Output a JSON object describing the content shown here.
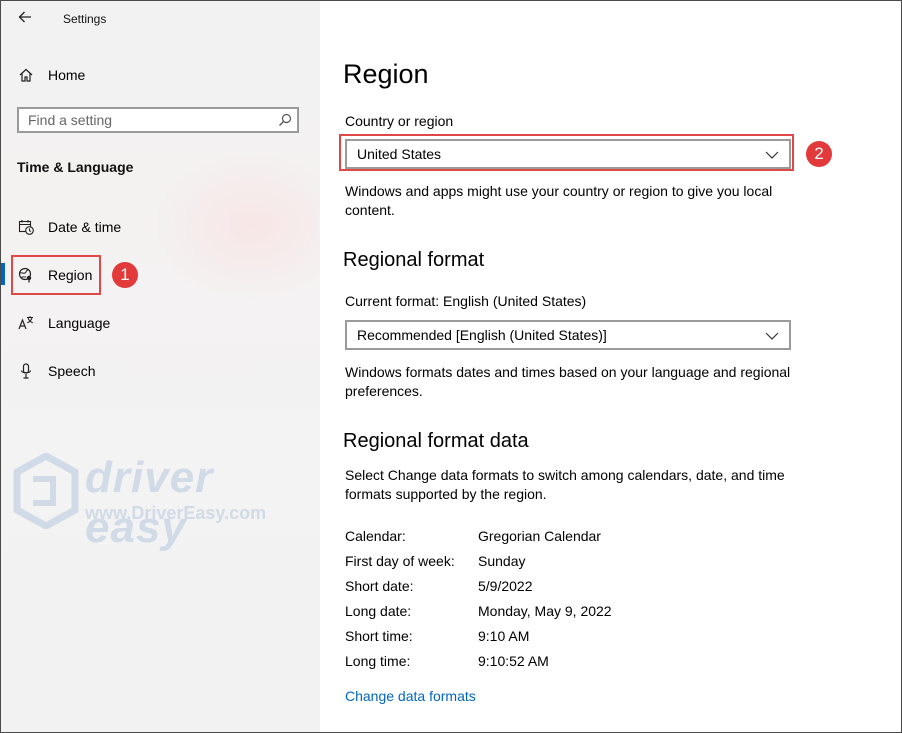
{
  "window": {
    "title": "Settings"
  },
  "sidebar": {
    "home_label": "Home",
    "search": {
      "placeholder": "Find a setting",
      "value": ""
    },
    "section_title": "Time & Language",
    "items": [
      {
        "label": "Date & time",
        "icon": "calendar-clock-icon"
      },
      {
        "label": "Region",
        "icon": "globe-region-icon",
        "selected": true
      },
      {
        "label": "Language",
        "icon": "language-icon"
      },
      {
        "label": "Speech",
        "icon": "microphone-icon"
      }
    ]
  },
  "main": {
    "title": "Region",
    "country": {
      "label": "Country or region",
      "selected": "United States",
      "description": "Windows and apps might use your country or region to give you local content."
    },
    "regional_format": {
      "heading": "Regional format",
      "current_label": "Current format: English (United States)",
      "selected": "Recommended [English (United States)]",
      "description": "Windows formats dates and times based on your language and regional preferences."
    },
    "format_data": {
      "heading": "Regional format data",
      "description": "Select Change data formats to switch among calendars, date, and time formats supported by the region.",
      "rows": [
        {
          "key": "Calendar:",
          "value": "Gregorian Calendar"
        },
        {
          "key": "First day of week:",
          "value": "Sunday"
        },
        {
          "key": "Short date:",
          "value": "5/9/2022"
        },
        {
          "key": "Long date:",
          "value": "Monday, May 9, 2022"
        },
        {
          "key": "Short time:",
          "value": "9:10 AM"
        },
        {
          "key": "Long time:",
          "value": "9:10:52 AM"
        }
      ],
      "link": "Change data formats"
    }
  },
  "annotations": {
    "step1": "1",
    "step2": "2"
  },
  "watermark": {
    "brand": "driver easy",
    "url": "www.DriverEasy.com"
  },
  "colors": {
    "accent": "#0067c0",
    "highlight": "#e04848",
    "badge": "#e23a3a"
  }
}
